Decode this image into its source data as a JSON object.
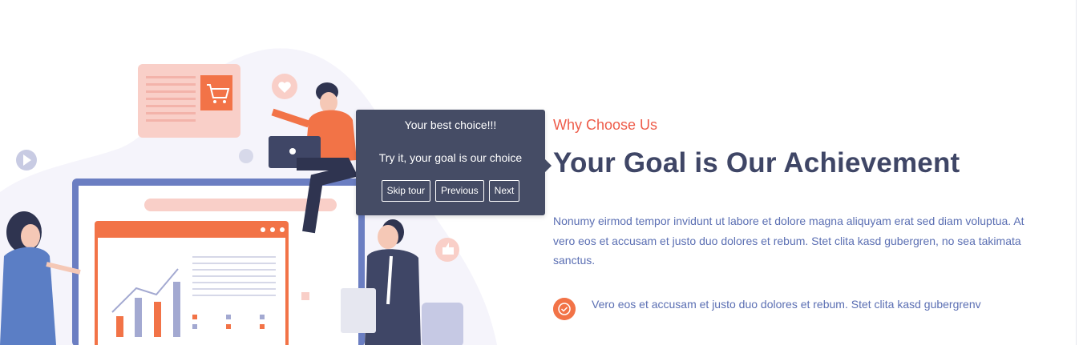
{
  "tour": {
    "title": "Your best choice!!!",
    "text": "Try it, your goal is our choice",
    "skip_label": "Skip tour",
    "previous_label": "Previous",
    "next_label": "Next"
  },
  "section": {
    "subtitle": "Why Choose Us",
    "title": "Your Goal is Our Achievement",
    "paragraph": "Nonumy eirmod tempor invidunt ut labore et dolore magna aliquyam erat sed diam voluptua. At vero eos et accusam et justo duo dolores et rebum. Stet clita kasd gubergren, no sea takimata sanctus.",
    "features": [
      {
        "icon": "check-circle-icon",
        "text": "Vero eos et accusam et justo duo dolores et rebum. Stet clita kasd gubergrenv"
      }
    ]
  },
  "colors": {
    "accent": "#f27347",
    "subtitle": "#ee5c4a",
    "title": "#3f4666",
    "body_text": "#5b6fb3",
    "tooltip_bg": "#454c65"
  }
}
